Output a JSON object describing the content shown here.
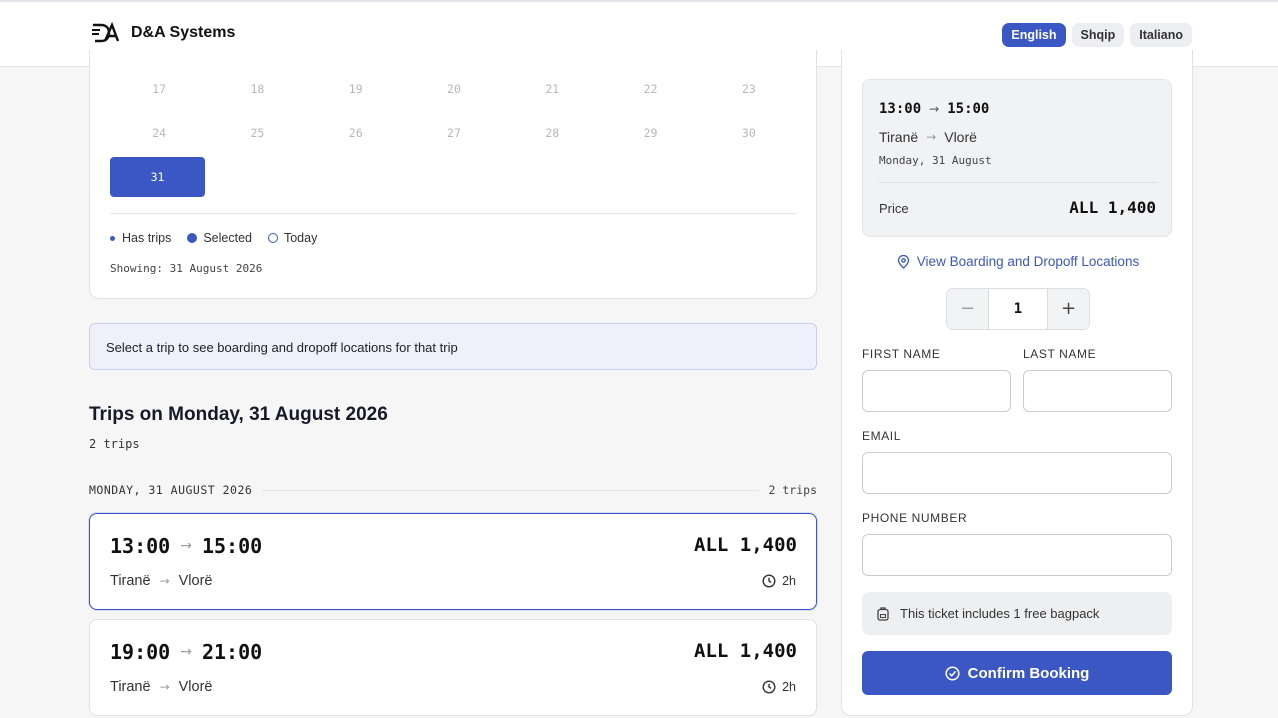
{
  "header": {
    "brand_name": "D&A Systems",
    "languages": [
      {
        "label": "English",
        "active": true
      },
      {
        "label": "Shqip",
        "active": false
      },
      {
        "label": "Italiano",
        "active": false
      }
    ]
  },
  "calendar": {
    "rows": [
      [
        "17",
        "18",
        "19",
        "20",
        "21",
        "22",
        "23"
      ],
      [
        "24",
        "25",
        "26",
        "27",
        "28",
        "29",
        "30"
      ]
    ],
    "selected_day": "31",
    "legend": {
      "has_trips": "Has trips",
      "selected": "Selected",
      "today": "Today"
    },
    "showing": "Showing: 31 August 2026"
  },
  "info_message": "Select a trip to see boarding and dropoff locations for that trip",
  "trips_section": {
    "title": "Trips on Monday, 31 August 2026",
    "count": "2 trips",
    "day_label": "MONDAY, 31 AUGUST 2026",
    "day_count": "2 trips",
    "trips": [
      {
        "depart": "13:00",
        "arrive": "15:00",
        "price": "ALL 1,400",
        "from": "Tiranë",
        "to": "Vlorë",
        "duration": "2h",
        "selected": true
      },
      {
        "depart": "19:00",
        "arrive": "21:00",
        "price": "ALL 1,400",
        "from": "Tiranë",
        "to": "Vlorë",
        "duration": "2h",
        "selected": false
      }
    ]
  },
  "booking": {
    "summary": {
      "depart": "13:00",
      "arrive": "15:00",
      "from": "Tiranë",
      "to": "Vlorë",
      "date": "Monday, 31 August",
      "price_label": "Price",
      "price_value": "ALL 1,400"
    },
    "locations_link": "View Boarding and Dropoff Locations",
    "quantity": {
      "minus": "−",
      "value": "1",
      "plus": "+"
    },
    "fields": {
      "first_name": "FIRST NAME",
      "last_name": "LAST NAME",
      "email": "EMAIL",
      "phone": "PHONE NUMBER"
    },
    "bag_note": "This ticket includes 1 free bagpack",
    "confirm_label": "Confirm Booking"
  },
  "colors": {
    "accent": "#3a57c4",
    "border": "#dfe1e6",
    "background": "#f6f6f6"
  }
}
